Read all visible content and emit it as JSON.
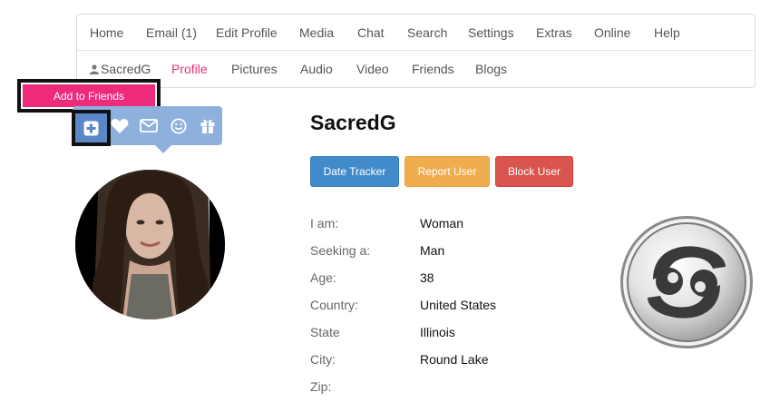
{
  "nav": {
    "top": [
      "Home",
      "Email (1)",
      "Edit Profile",
      "Media",
      "Chat",
      "Search",
      "Settings",
      "Extras",
      "Online",
      "Help"
    ],
    "bottom": [
      "SacredG",
      "Profile",
      "Pictures",
      "Audio",
      "Video",
      "Friends",
      "Blogs"
    ],
    "active": "Profile"
  },
  "tooltip": {
    "label": "Add to Friends"
  },
  "action_bar": {
    "icons": [
      "plus-square-icon",
      "heart-icon",
      "envelope-icon",
      "smile-icon",
      "gift-icon"
    ]
  },
  "profile": {
    "username": "SacredG",
    "buttons": {
      "date_tracker": "Date Tracker",
      "report_user": "Report User",
      "block_user": "Block User"
    },
    "details": [
      {
        "label": "I am:",
        "value": "Woman"
      },
      {
        "label": "Seeking a:",
        "value": "Man"
      },
      {
        "label": "Age:",
        "value": "38"
      },
      {
        "label": "Country:",
        "value": "United States"
      },
      {
        "label": "State",
        "value": "Illinois"
      },
      {
        "label": "City:",
        "value": "Round Lake"
      },
      {
        "label": "Zip:",
        "value": ""
      }
    ],
    "zodiac_icon": "cancer-zodiac-icon"
  },
  "colors": {
    "accent_pink": "#ee2a7b",
    "action_bar_blue": "#8eb0dd",
    "primary": "#428bca",
    "warning": "#f0ad4e",
    "danger": "#d9534f"
  }
}
